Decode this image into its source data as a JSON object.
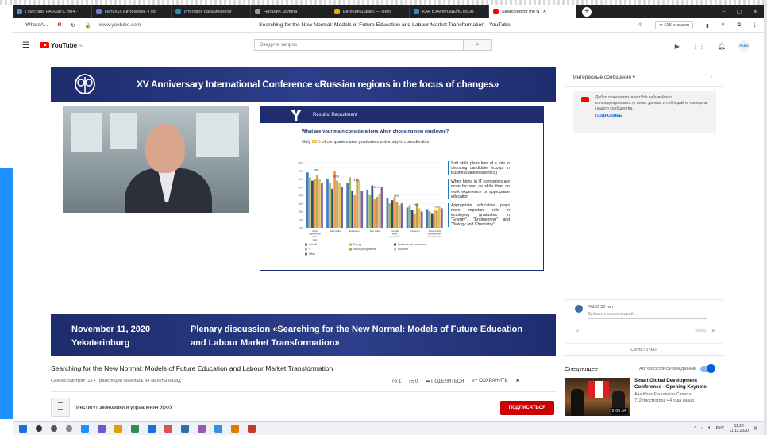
{
  "browser": {
    "tabs": [
      {
        "label": "Подстава РАНХиГС.mp4 -",
        "color": "#4a90d9"
      },
      {
        "label": "Наталья Евтинеева - Пер",
        "color": "#6e7bd9"
      },
      {
        "label": "Итоговое расширенное",
        "color": "#2e8bc0"
      },
      {
        "label": "Наталия Долина",
        "color": "#999999"
      },
      {
        "label": "Евгения Шамис — Перс",
        "color": "#e0b000"
      },
      {
        "label": "КАК ВЗАИМОДЕЙСТВОВ",
        "color": "#2e8bc0"
      },
      {
        "label": "Searching for the N",
        "color": "#ff0000",
        "active": true
      }
    ],
    "back_label": "← WhatsA...",
    "url": "www.youtube.com",
    "page_title": "Searching for the New Normal: Models of Future Education and Labour Market Transformation - YouTube",
    "reviews": "★ 61К отзывов"
  },
  "youtube": {
    "region": "RU",
    "search_placeholder": "Введите запрос",
    "avatar_label": "РАБО"
  },
  "video": {
    "banner_title": "XV Anniversary International Conference «Russian regions in the focus of changes»",
    "date_line1": "November 11, 2020",
    "date_line2": "Yekaterinburg",
    "plenary_line1": "Plenary discussion «Searching for the New Normal: Models of Future Education",
    "plenary_line2": "and Labour Market Transformation»",
    "slide": {
      "header": "Results: Recruitment",
      "question": "What are your main considerations when choosing new employee?",
      "subtitle_pre": "Only ",
      "subtitle_pct": "25%",
      "subtitle_post": " of companies take graduate's university in consideration",
      "notes": [
        "Soft skills plays less of a role in choosing candidate (except in Business and economics)",
        "When hiring in IT companies are more focused on skills than on work experience or appropriate education",
        "Appropriate education plays more important role in employing graduates in \"Energy\", \"Engineering\" and \"Biology and Chemistry\""
      ]
    }
  },
  "chart_data": {
    "type": "bar",
    "categories": [
      "Work experience in the field",
      "Hard skills",
      "Education",
      "Soft skills",
      "Overall work experience",
      "University",
      "Sustainable development competencies"
    ],
    "ylim": [
      0,
      80
    ],
    "yticks": [
      "0%",
      "10%",
      "20%",
      "30%",
      "40%",
      "50%",
      "60%",
      "70%",
      "80%"
    ],
    "annotations": [
      "68%",
      "60%",
      "47%",
      "54%",
      "36%",
      "25%",
      "23%"
    ],
    "series": [
      {
        "name": "Overall",
        "color": "#4a7bb7",
        "values": [
          68,
          60,
          55,
          47,
          36,
          25,
          23
        ]
      },
      {
        "name": "Energy",
        "color": "#9bbb59",
        "values": [
          62,
          55,
          62,
          40,
          30,
          28,
          20
        ]
      },
      {
        "name": "Business and economics",
        "color": "#2c4d75",
        "values": [
          58,
          48,
          45,
          52,
          34,
          22,
          18
        ]
      },
      {
        "name": "IT",
        "color": "#f79646",
        "values": [
          60,
          70,
          40,
          35,
          38,
          18,
          22
        ]
      },
      {
        "name": "Industry/Engineering",
        "color": "#c0a050",
        "values": [
          65,
          58,
          60,
          38,
          32,
          30,
          21
        ]
      },
      {
        "name": "Bio/chem",
        "color": "#e0c060",
        "values": [
          60,
          55,
          58,
          42,
          28,
          24,
          26
        ]
      },
      {
        "name": "Other",
        "color": "#8064a2",
        "values": [
          55,
          50,
          45,
          50,
          30,
          20,
          24
        ]
      }
    ]
  },
  "below_video": {
    "title": "Searching for the New Normal: Models of Future Education and Labour Market Transformation",
    "meta": "Сейчас смотрят: 13 • Трансляция началась 84 минуты назад",
    "likes": "1",
    "dislikes": "0",
    "share": "ПОДЕЛИТЬСЯ",
    "save": "СОХРАНИТЬ",
    "channel_name": "Институт экономики и управления УрФУ",
    "subscribe": "ПОДПИСАТЬСЯ"
  },
  "chat": {
    "header": "Интересные сообщения ▾",
    "notice": "Добро пожаловать в чат! Не забывайте о конфиденциальности своих данных и соблюдайте принципы нашего сообщества.",
    "notice_more": "ПОДРОБНЕЕ",
    "user": "РАБО 30 лет",
    "input_placeholder": "Добавить комментарий...",
    "counter": "0/200",
    "hide": "СКРЫТЬ ЧАТ"
  },
  "upnext": {
    "label": "Следующее",
    "autoplay": "АВТОВОСПРОИЗВЕДЕНИЕ",
    "title": "Smart Global Development Conference - Opening Keynote",
    "channel": "Aga Khan Foundation Canada",
    "views": "712 просмотров • 4 года назад",
    "duration": "2:05:54"
  },
  "taskbar": {
    "lang": "РУС",
    "time": "11:23",
    "date": "11.11.2020"
  }
}
